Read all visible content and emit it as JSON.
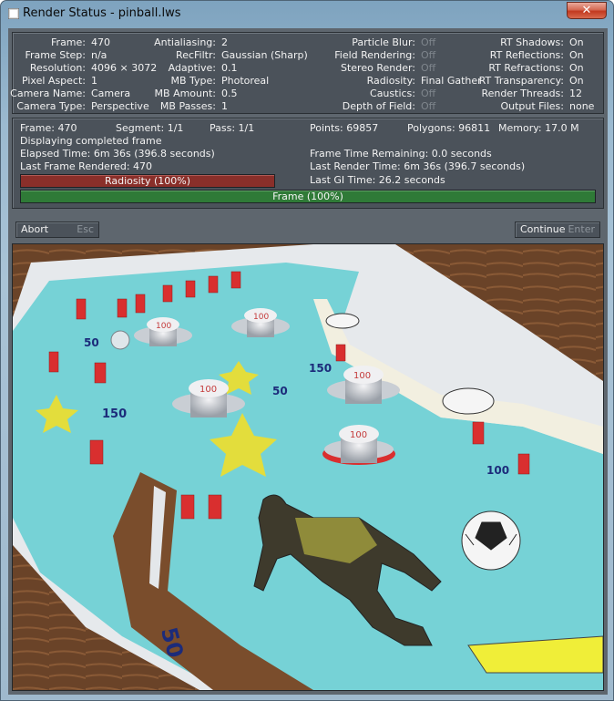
{
  "window": {
    "title": "Render Status - pinball.lws",
    "close_symbol": "✕"
  },
  "info": {
    "col1": [
      {
        "label": "Frame:",
        "value": "470"
      },
      {
        "label": "Frame Step:",
        "value": "n/a"
      },
      {
        "label": "Resolution:",
        "value": "4096 × 3072"
      },
      {
        "label": "Pixel Aspect:",
        "value": "1"
      },
      {
        "label": "Camera Name:",
        "value": "Camera"
      },
      {
        "label": "Camera Type:",
        "value": "Perspective"
      }
    ],
    "col2": [
      {
        "label": "Antialiasing:",
        "value": "2"
      },
      {
        "label": "RecFiltr:",
        "value": "Gaussian (Sharp)"
      },
      {
        "label": "Adaptive:",
        "value": "0.1"
      },
      {
        "label": "MB Type:",
        "value": "Photoreal"
      },
      {
        "label": "MB Amount:",
        "value": "0.5"
      },
      {
        "label": "MB Passes:",
        "value": "1"
      }
    ],
    "col3": [
      {
        "label": "Particle Blur:",
        "value": "Off"
      },
      {
        "label": "Field Rendering:",
        "value": "Off"
      },
      {
        "label": "Stereo Render:",
        "value": "Off"
      },
      {
        "label": "Radiosity:",
        "value": "Final Gather"
      },
      {
        "label": "Caustics:",
        "value": "Off"
      },
      {
        "label": "Depth of Field:",
        "value": "Off"
      }
    ],
    "col4": [
      {
        "label": "RT Shadows:",
        "value": "On"
      },
      {
        "label": "RT Reflections:",
        "value": "On"
      },
      {
        "label": "RT Refractions:",
        "value": "On"
      },
      {
        "label": "RT Transparency:",
        "value": "On"
      },
      {
        "label": "Render Threads:",
        "value": "12"
      },
      {
        "label": "Output Files:",
        "value": "none"
      }
    ]
  },
  "status": {
    "frame": "Frame: 470",
    "segment": "Segment: 1/1",
    "pass": "Pass: 1/1",
    "points": "Points: 69857",
    "polygons": "Polygons: 96811",
    "memory": "Memory: 17.0 M",
    "message": "Displaying completed frame",
    "elapsed": "Elapsed Time: 6m 36s (396.8 seconds)",
    "last_frame": "Last Frame Rendered: 470",
    "remaining": "Frame Time Remaining: 0.0 seconds",
    "last_render": "Last Render Time: 6m 36s (396.7 seconds)",
    "last_gi": "Last GI Time: 26.2 seconds",
    "radiosity_bar": "Radiosity (100%)",
    "radiosity_progress": 1.0,
    "frame_bar": "Frame (100%)",
    "frame_progress": 1.0
  },
  "buttons": {
    "abort": "Abort",
    "abort_key": "Esc",
    "continue": "Continue",
    "continue_key": "Enter"
  },
  "scene": {
    "bumper_label": "100",
    "target_labels": [
      "50",
      "150",
      "150",
      "50",
      "100",
      "50"
    ],
    "colors": {
      "wood": "#6a4328",
      "playfield": "#76d2d6",
      "post": "#d92f2f",
      "star": "#e3dd3c"
    }
  }
}
